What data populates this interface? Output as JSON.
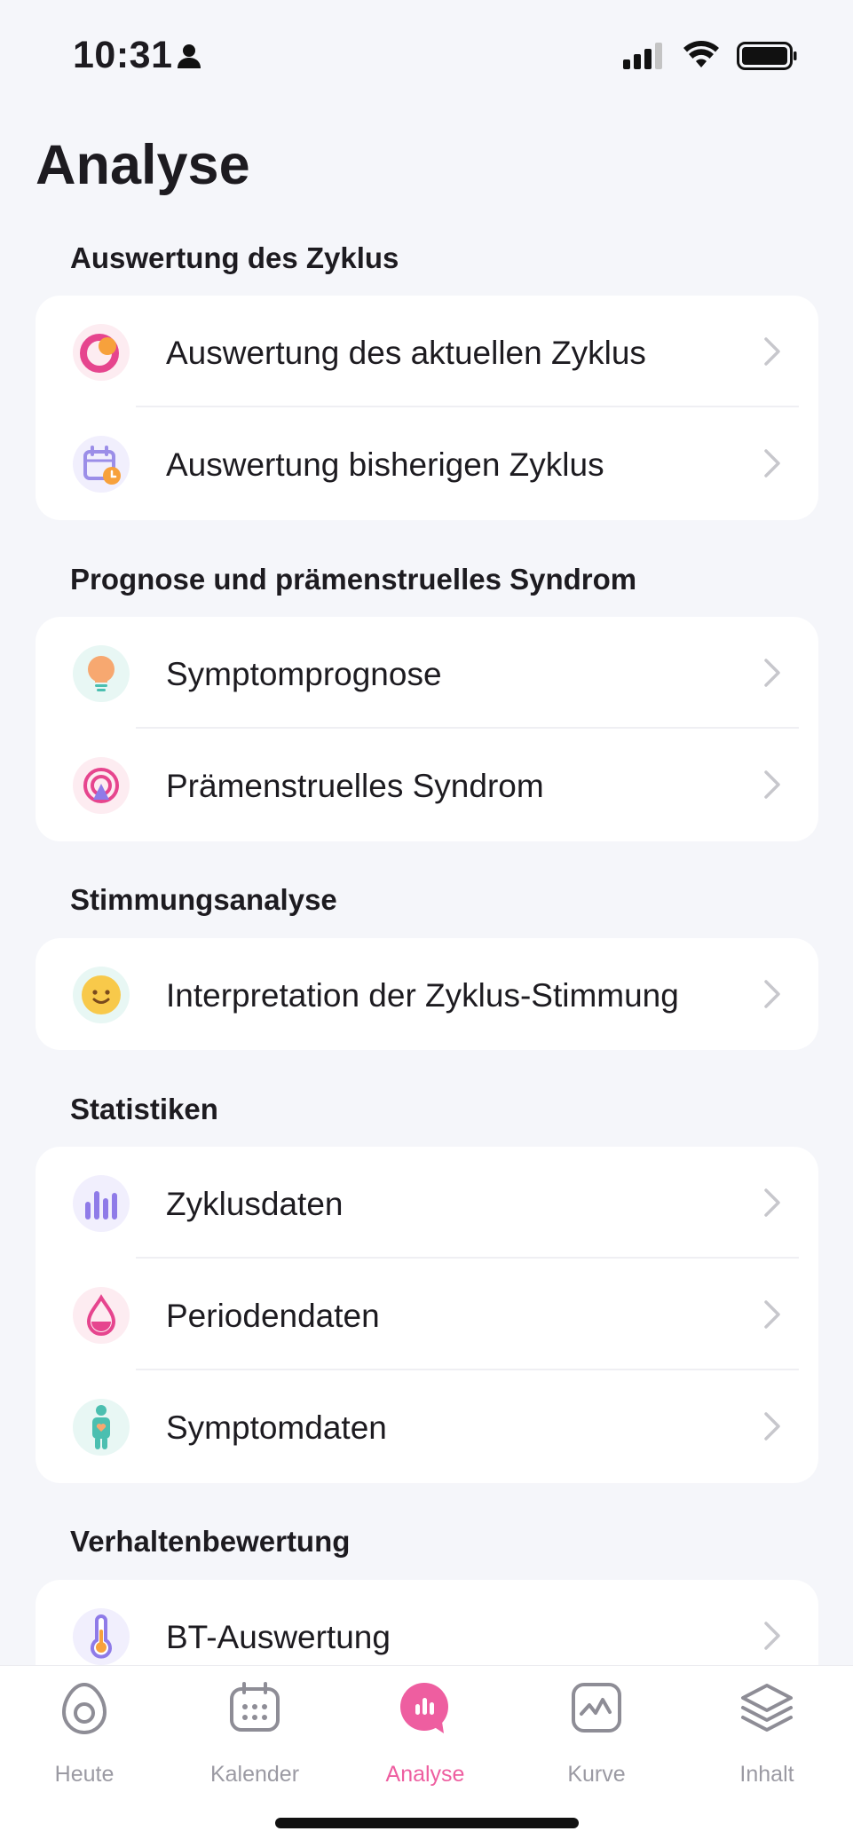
{
  "status_bar": {
    "time": "10:31"
  },
  "page": {
    "title": "Analyse"
  },
  "sections": [
    {
      "header": "Auswertung des Zyklus",
      "items": [
        {
          "label": "Auswertung des aktuellen Zyklus",
          "icon": "cycle-ring-icon"
        },
        {
          "label": "Auswertung bisherigen Zyklus",
          "icon": "calendar-clock-icon"
        }
      ]
    },
    {
      "header": "Prognose und prämenstruelles Syndrom",
      "items": [
        {
          "label": "Symptomprognose",
          "icon": "lightbulb-icon"
        },
        {
          "label": "Prämenstruelles Syndrom",
          "icon": "radar-icon"
        }
      ]
    },
    {
      "header": "Stimmungsanalyse",
      "items": [
        {
          "label": "Interpretation der Zyklus-Stimmung",
          "icon": "smiley-icon"
        }
      ]
    },
    {
      "header": "Statistiken",
      "items": [
        {
          "label": "Zyklusdaten",
          "icon": "bar-chart-icon"
        },
        {
          "label": "Periodendaten",
          "icon": "drop-icon"
        },
        {
          "label": "Symptomdaten",
          "icon": "body-icon"
        }
      ]
    },
    {
      "header": "Verhaltenbewertung",
      "items": [
        {
          "label": "BT-Auswertung",
          "icon": "thermometer-icon"
        }
      ]
    }
  ],
  "tabs": [
    {
      "label": "Heute",
      "icon": "egg-icon",
      "active": false
    },
    {
      "label": "Kalender",
      "icon": "calendar-icon",
      "active": false
    },
    {
      "label": "Analyse",
      "icon": "analysis-icon",
      "active": true
    },
    {
      "label": "Kurve",
      "icon": "curve-icon",
      "active": false
    },
    {
      "label": "Inhalt",
      "icon": "layers-icon",
      "active": false
    }
  ],
  "colors": {
    "accent": "#ee5ea0",
    "background": "#f5f6fa",
    "inactive_tab": "#9b9aa3"
  }
}
